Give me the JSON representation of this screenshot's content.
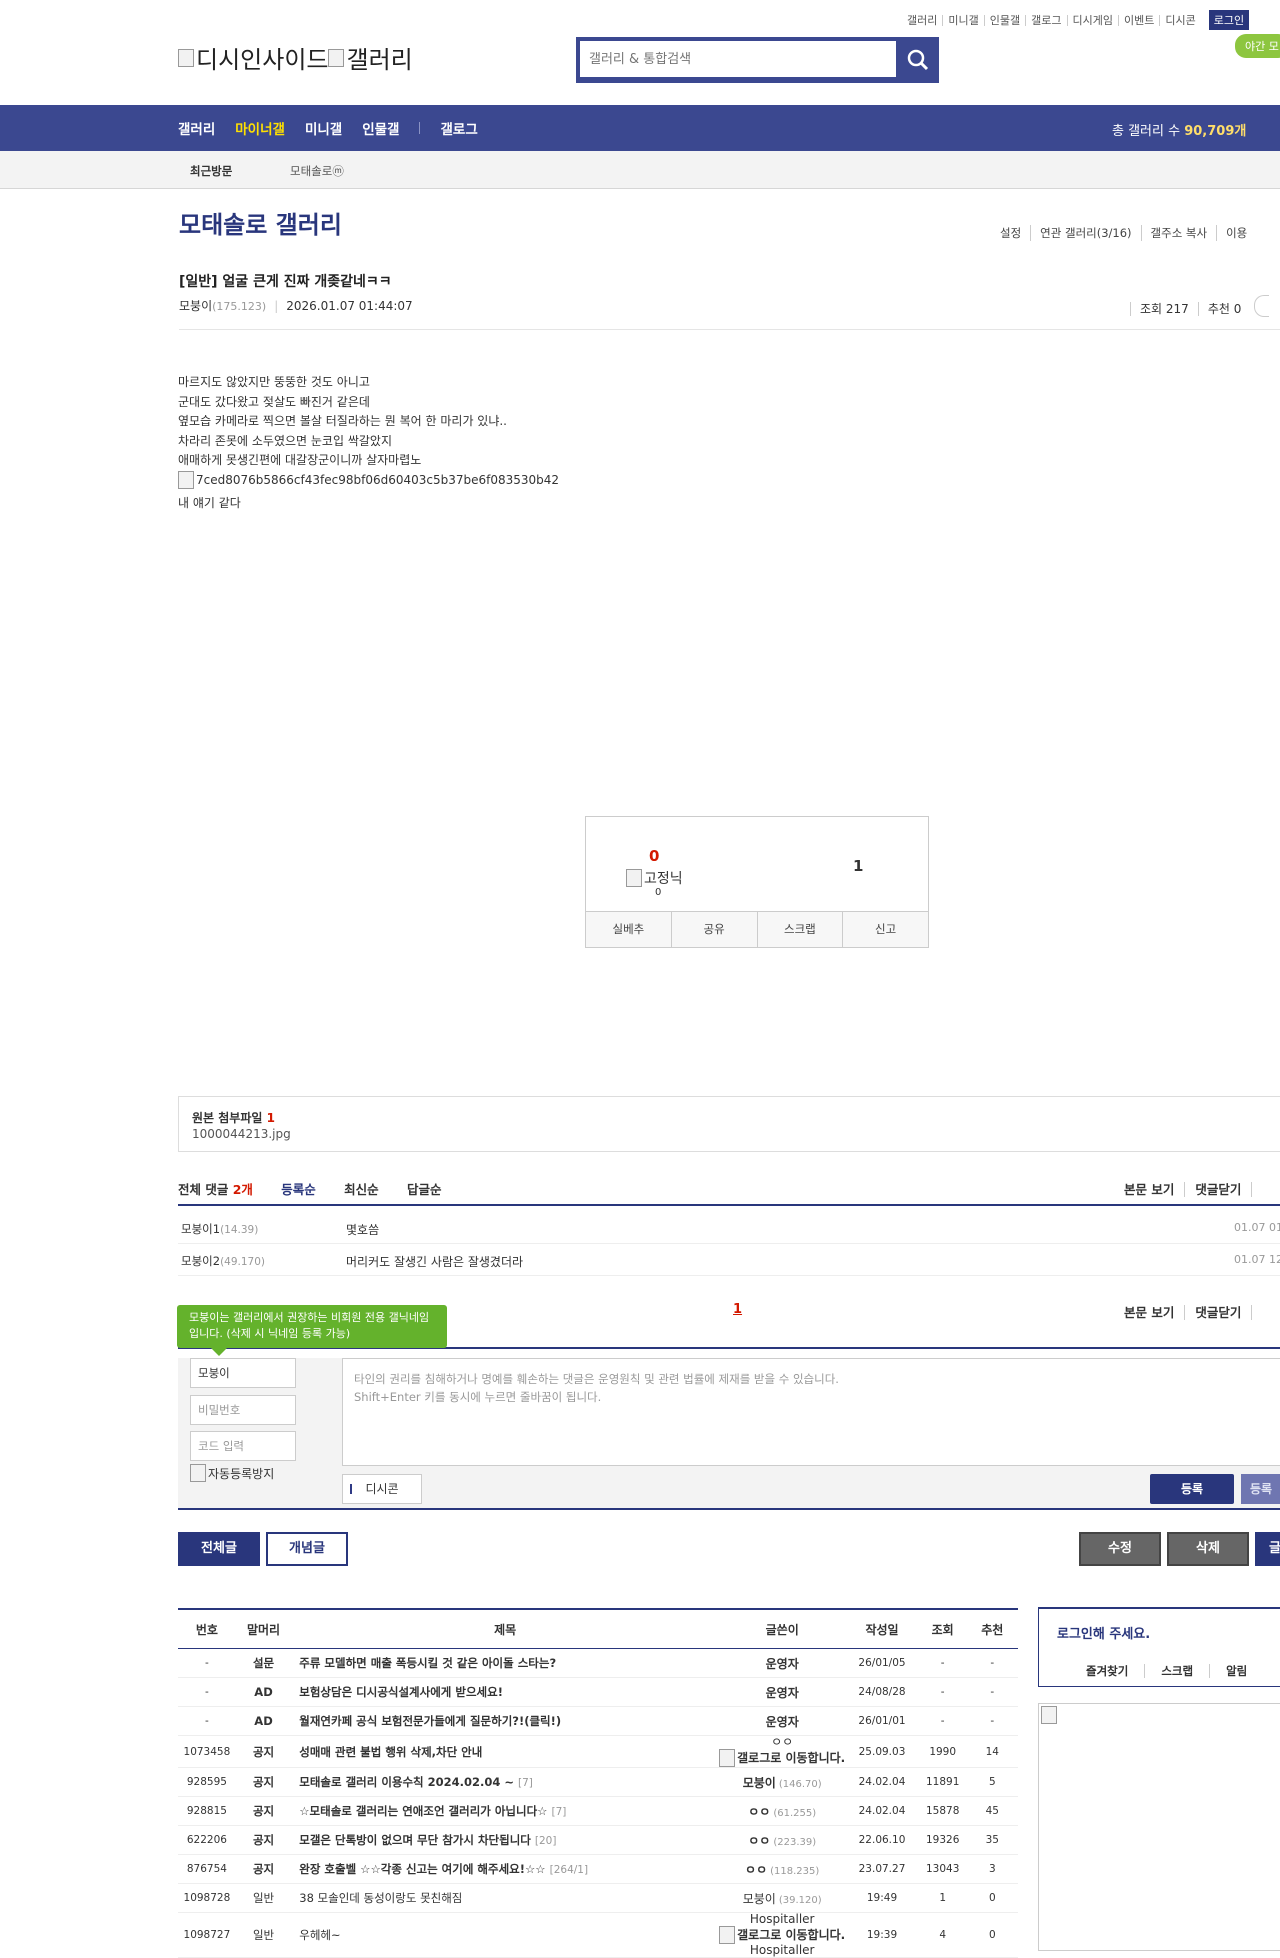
{
  "util": {
    "links": [
      "갤러리",
      "미니갤",
      "인물갤",
      "갤로그",
      "디시게임",
      "이벤트",
      "디시콘"
    ],
    "login": "로그인",
    "night": "야간 모"
  },
  "logo": {
    "alt1": "디시인사이드",
    "alt2": "갤러리"
  },
  "search": {
    "placeholder": "갤러리 & 통합검색"
  },
  "gnb": {
    "menu": [
      "갤러리",
      "마이너갤",
      "미니갤",
      "인물갤",
      "갤로그"
    ],
    "total_label": "총 갤러리 수 ",
    "total_value": "90,709개"
  },
  "visit": {
    "label": "최근방문",
    "item": "모태솔로ⓜ"
  },
  "gallery": {
    "title": "모태솔로 갤러리",
    "tools": [
      "설정",
      "연관 갤러리(3/16)",
      "갤주소 복사",
      "이용"
    ]
  },
  "post": {
    "title": "[일반] 얼굴 큰게 진짜 개좆같네ㅋㅋ",
    "author": "모붕이",
    "ip": "(175.123)",
    "date": "2026.01.07 01:44:07",
    "views": "조회 217",
    "recommend": "추천 0",
    "body": [
      "마르지도 않았지만 뚱뚱한 것도 아니고",
      "군대도 갔다왔고 젖살도 빠진거 같은데",
      "옆모습 카메라로 찍으면 볼살 터질라하는 뭔 복어 한 마리가 있냐..",
      "차라리 존못에 소두였으면 눈코입 싹갈았지",
      "애매하게 못생긴편에 대갈장군이니까 살자마렵노"
    ],
    "image_alt": "7ced8076b5866cf43fec98bf06d60403c5b37be6f083530b42",
    "tail": "내 얘기 같다"
  },
  "rec": {
    "up": "0",
    "fixed_alt": "고정닉",
    "fixed_count": "0",
    "down": "1",
    "buttons": [
      "실베추",
      "공유",
      "스크랩",
      "신고"
    ]
  },
  "attach": {
    "label": "원본 첨부파일 ",
    "count": "1",
    "file": "1000044213.jpg"
  },
  "comments": {
    "total_label": "전체 댓글 ",
    "total_count": "2개",
    "sorts": [
      "등록순",
      "최신순",
      "답글순"
    ],
    "right": [
      "본문 보기",
      "댓글닫기",
      ""
    ],
    "list": [
      {
        "name": "모붕이1",
        "ip": "(14.39)",
        "text": "몇호씀",
        "date": "01.07 01"
      },
      {
        "name": "모붕이2",
        "ip": "(49.170)",
        "text": "머리커도 잘생긴 사람은 잘생겼더라",
        "date": "01.07 12"
      }
    ],
    "page": "1",
    "bottom": [
      "본문 보기",
      "댓글닫기",
      ""
    ]
  },
  "write": {
    "tip": "모붕이는 갤러리에서 권장하는 비회원 전용 갤닉네임입니다. (삭제 시 닉네임 등록 가능)",
    "nick": "모붕이",
    "pw_ph": "비밀번호",
    "code_ph": "코드 입력",
    "captcha_alt": "자동등록방지",
    "notice1": "타인의 권리를 침해하거나 명예를 훼손하는 댓글은 운영원칙 및 관련 법률에 제재를 받을 수 있습니다.",
    "notice2": "Shift+Enter 키를 동시에 누르면 줄바꿈이 됩니다.",
    "dccon": "디시콘",
    "reg": "등록",
    "reg2": "등록"
  },
  "buttons": {
    "all": "전체글",
    "concept": "개념글",
    "edit": "수정",
    "del": "삭제",
    "write": "글"
  },
  "list": {
    "headers": [
      "번호",
      "말머리",
      "제목",
      "글쓴이",
      "작성일",
      "조회",
      "추천"
    ],
    "rows": [
      {
        "no": "-",
        "head": "설문",
        "title": "주류 모델하면 매출 폭등시킬 것 같은 아이돌 스타는?",
        "reply": "",
        "writer": "운영자",
        "wip": "",
        "date": "26/01/05",
        "views": "-",
        "rec": "-",
        "bold": true
      },
      {
        "no": "-",
        "head": "AD",
        "title": "보험상담은 디시공식설계사에게 받으세요!",
        "reply": "",
        "writer": "운영자",
        "wip": "",
        "date": "24/08/28",
        "views": "-",
        "rec": "-",
        "bold": true
      },
      {
        "no": "-",
        "head": "AD",
        "title": "월재연카페 공식 보험전문가들에게 질문하기?!(클릭!)",
        "reply": "",
        "writer": "운영자",
        "wip": "",
        "date": "26/01/01",
        "views": "-",
        "rec": "-",
        "bold": true
      },
      {
        "no": "1073458",
        "head": "공지",
        "title": "성매매 관련 불법 행위 삭제,차단 안내",
        "reply": "",
        "writer": "ㅇㅇ",
        "wip": "갤로그로 이동합니다.",
        "date": "25.09.03",
        "views": "1990",
        "rec": "14",
        "bold": true,
        "glog": true
      },
      {
        "no": "928595",
        "head": "공지",
        "title": "모태솔로 갤러리 이용수칙 2024.02.04 ~",
        "reply": "[7]",
        "writer": "모붕이",
        "wip": "(146.70)",
        "date": "24.02.04",
        "views": "11891",
        "rec": "5",
        "bold": true
      },
      {
        "no": "928815",
        "head": "공지",
        "title": "☆모태솔로 갤러리는 연애조언 갤러리가 아닙니다☆",
        "reply": "[7]",
        "writer": "ㅇㅇ",
        "wip": "(61.255)",
        "date": "24.02.04",
        "views": "15878",
        "rec": "45",
        "bold": true
      },
      {
        "no": "622206",
        "head": "공지",
        "title": "모갤은 단톡방이 없으며 무단 참가시 차단됩니다",
        "reply": "[20]",
        "writer": "ㅇㅇ",
        "wip": "(223.39)",
        "date": "22.06.10",
        "views": "19326",
        "rec": "35",
        "bold": true
      },
      {
        "no": "876754",
        "head": "공지",
        "title": "완장 호출벨 ☆☆각종 신고는 여기에 해주세요!☆☆",
        "reply": "[264/1]",
        "writer": "ㅇㅇ",
        "wip": "(118.235)",
        "date": "23.07.27",
        "views": "13043",
        "rec": "3",
        "bold": true
      },
      {
        "no": "1098728",
        "head": "일반",
        "title": "38 모솔인데 동성이랑도 못친해짐",
        "reply": "",
        "writer": "모붕이",
        "wip": "(39.120)",
        "date": "19:49",
        "views": "1",
        "rec": "0",
        "bold": false
      },
      {
        "no": "1098727",
        "head": "일반",
        "title": "우헤헤~",
        "reply": "",
        "writer": "Hospitaller",
        "wip": "갤로그로 이동합니다.",
        "date": "19:39",
        "views": "4",
        "rec": "0",
        "bold": false,
        "glog": true,
        "extra": "Hospitaller"
      }
    ]
  },
  "side": {
    "title": "로그인해 주세요.",
    "links": [
      "즐겨찾기",
      "스크랩",
      "알림"
    ]
  }
}
